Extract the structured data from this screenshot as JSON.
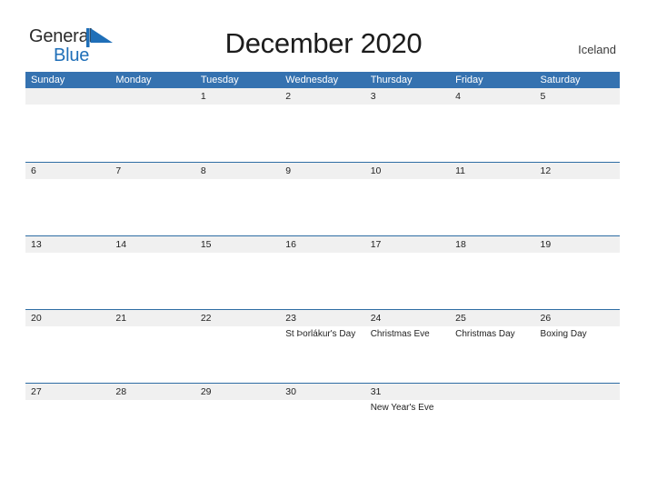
{
  "brand": {
    "name_part1": "General",
    "name_part2": "Blue",
    "flag_icon": "blue-triangle-flag-icon",
    "colors": {
      "text": "#2b2b2b",
      "blue": "#1f6fb8"
    }
  },
  "header": {
    "title": "December 2020",
    "country": "Iceland"
  },
  "theme": {
    "header_blue": "#3572b0",
    "row_border_blue": "#2e6da4",
    "band_gray": "#f0f0f0",
    "day_text": "#222222"
  },
  "calendar": {
    "weekdays": [
      "Sunday",
      "Monday",
      "Tuesday",
      "Wednesday",
      "Thursday",
      "Friday",
      "Saturday"
    ],
    "weeks": [
      [
        {
          "day": "",
          "event": ""
        },
        {
          "day": "",
          "event": ""
        },
        {
          "day": "1",
          "event": ""
        },
        {
          "day": "2",
          "event": ""
        },
        {
          "day": "3",
          "event": ""
        },
        {
          "day": "4",
          "event": ""
        },
        {
          "day": "5",
          "event": ""
        }
      ],
      [
        {
          "day": "6",
          "event": ""
        },
        {
          "day": "7",
          "event": ""
        },
        {
          "day": "8",
          "event": ""
        },
        {
          "day": "9",
          "event": ""
        },
        {
          "day": "10",
          "event": ""
        },
        {
          "day": "11",
          "event": ""
        },
        {
          "day": "12",
          "event": ""
        }
      ],
      [
        {
          "day": "13",
          "event": ""
        },
        {
          "day": "14",
          "event": ""
        },
        {
          "day": "15",
          "event": ""
        },
        {
          "day": "16",
          "event": ""
        },
        {
          "day": "17",
          "event": ""
        },
        {
          "day": "18",
          "event": ""
        },
        {
          "day": "19",
          "event": ""
        }
      ],
      [
        {
          "day": "20",
          "event": ""
        },
        {
          "day": "21",
          "event": ""
        },
        {
          "day": "22",
          "event": ""
        },
        {
          "day": "23",
          "event": "St Þorlákur's Day"
        },
        {
          "day": "24",
          "event": "Christmas Eve"
        },
        {
          "day": "25",
          "event": "Christmas Day"
        },
        {
          "day": "26",
          "event": "Boxing Day"
        }
      ],
      [
        {
          "day": "27",
          "event": ""
        },
        {
          "day": "28",
          "event": ""
        },
        {
          "day": "29",
          "event": ""
        },
        {
          "day": "30",
          "event": ""
        },
        {
          "day": "31",
          "event": "New Year's Eve"
        },
        {
          "day": "",
          "event": ""
        },
        {
          "day": "",
          "event": ""
        }
      ]
    ]
  }
}
